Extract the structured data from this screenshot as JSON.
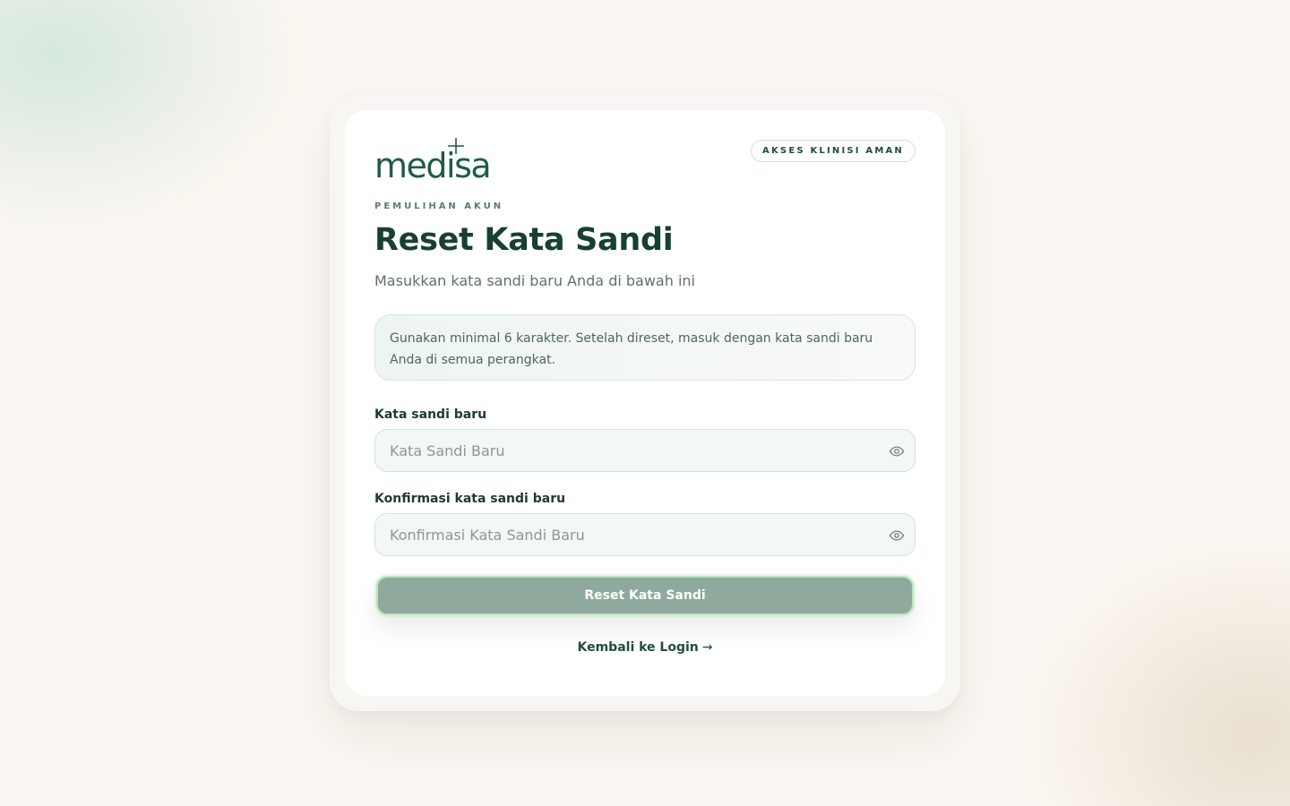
{
  "brand": {
    "logo_text": "medisa",
    "badge": "AKSES KLINISI AMAN"
  },
  "header": {
    "eyebrow": "PEMULIHAN AKUN",
    "title": "Reset Kata Sandi",
    "subtitle": "Masukkan kata sandi baru Anda di bawah ini"
  },
  "info": {
    "text": "Gunakan minimal 6 karakter. Setelah direset, masuk dengan kata sandi baru Anda di semua perangkat."
  },
  "form": {
    "new_password": {
      "label": "Kata sandi baru",
      "placeholder": "Kata Sandi Baru",
      "value": "",
      "icon": "eye-icon"
    },
    "confirm_password": {
      "label": "Konfirmasi kata sandi baru",
      "placeholder": "Konfirmasi Kata Sandi Baru",
      "value": "",
      "icon": "eye-icon"
    },
    "submit_label": "Reset Kata Sandi"
  },
  "footer": {
    "back_label": "Kembali ke Login",
    "back_arrow": "→"
  },
  "colors": {
    "brand_dark": "#17402f",
    "button_bg": "#8faa9c",
    "button_border": "#b8e6bf",
    "page_bg": "#fcf7f2"
  }
}
